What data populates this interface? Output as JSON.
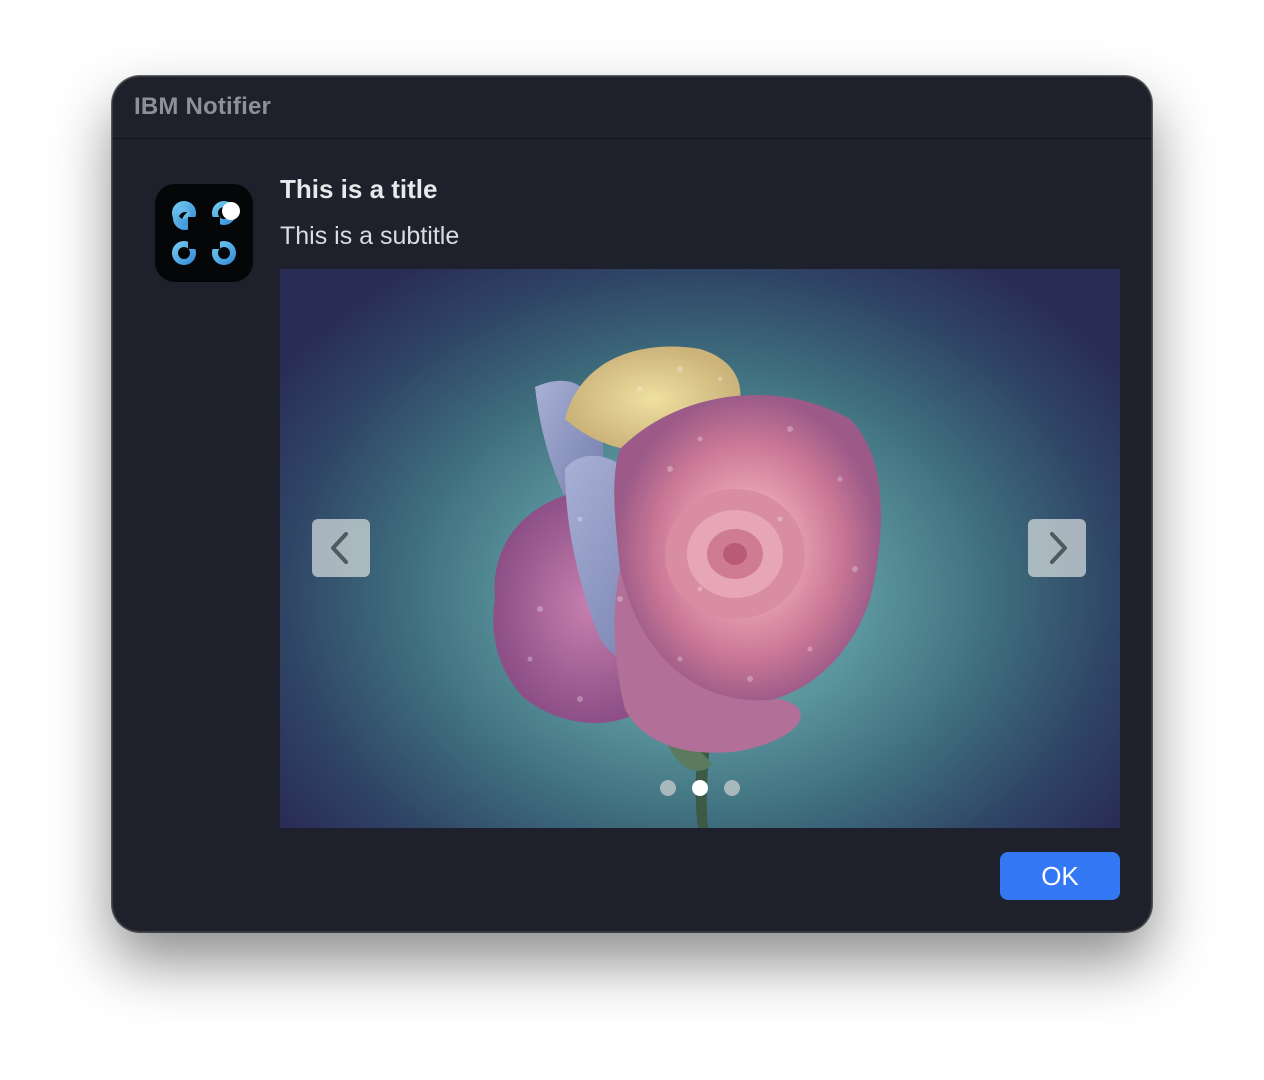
{
  "window": {
    "title": "IBM Notifier"
  },
  "message": {
    "title": "This is a title",
    "subtitle": "This is a subtitle"
  },
  "app_icon": {
    "icon": "command-key-icon",
    "badge": true
  },
  "carousel": {
    "image": "rose-photo",
    "prev_icon": "chevron-left-icon",
    "next_icon": "chevron-right-icon",
    "page_count": 3,
    "current_page": 2
  },
  "buttons": {
    "ok_label": "OK"
  },
  "colors": {
    "window_background": "#1e202b",
    "accent": "#3478f6",
    "title_text": "#8e9097"
  }
}
